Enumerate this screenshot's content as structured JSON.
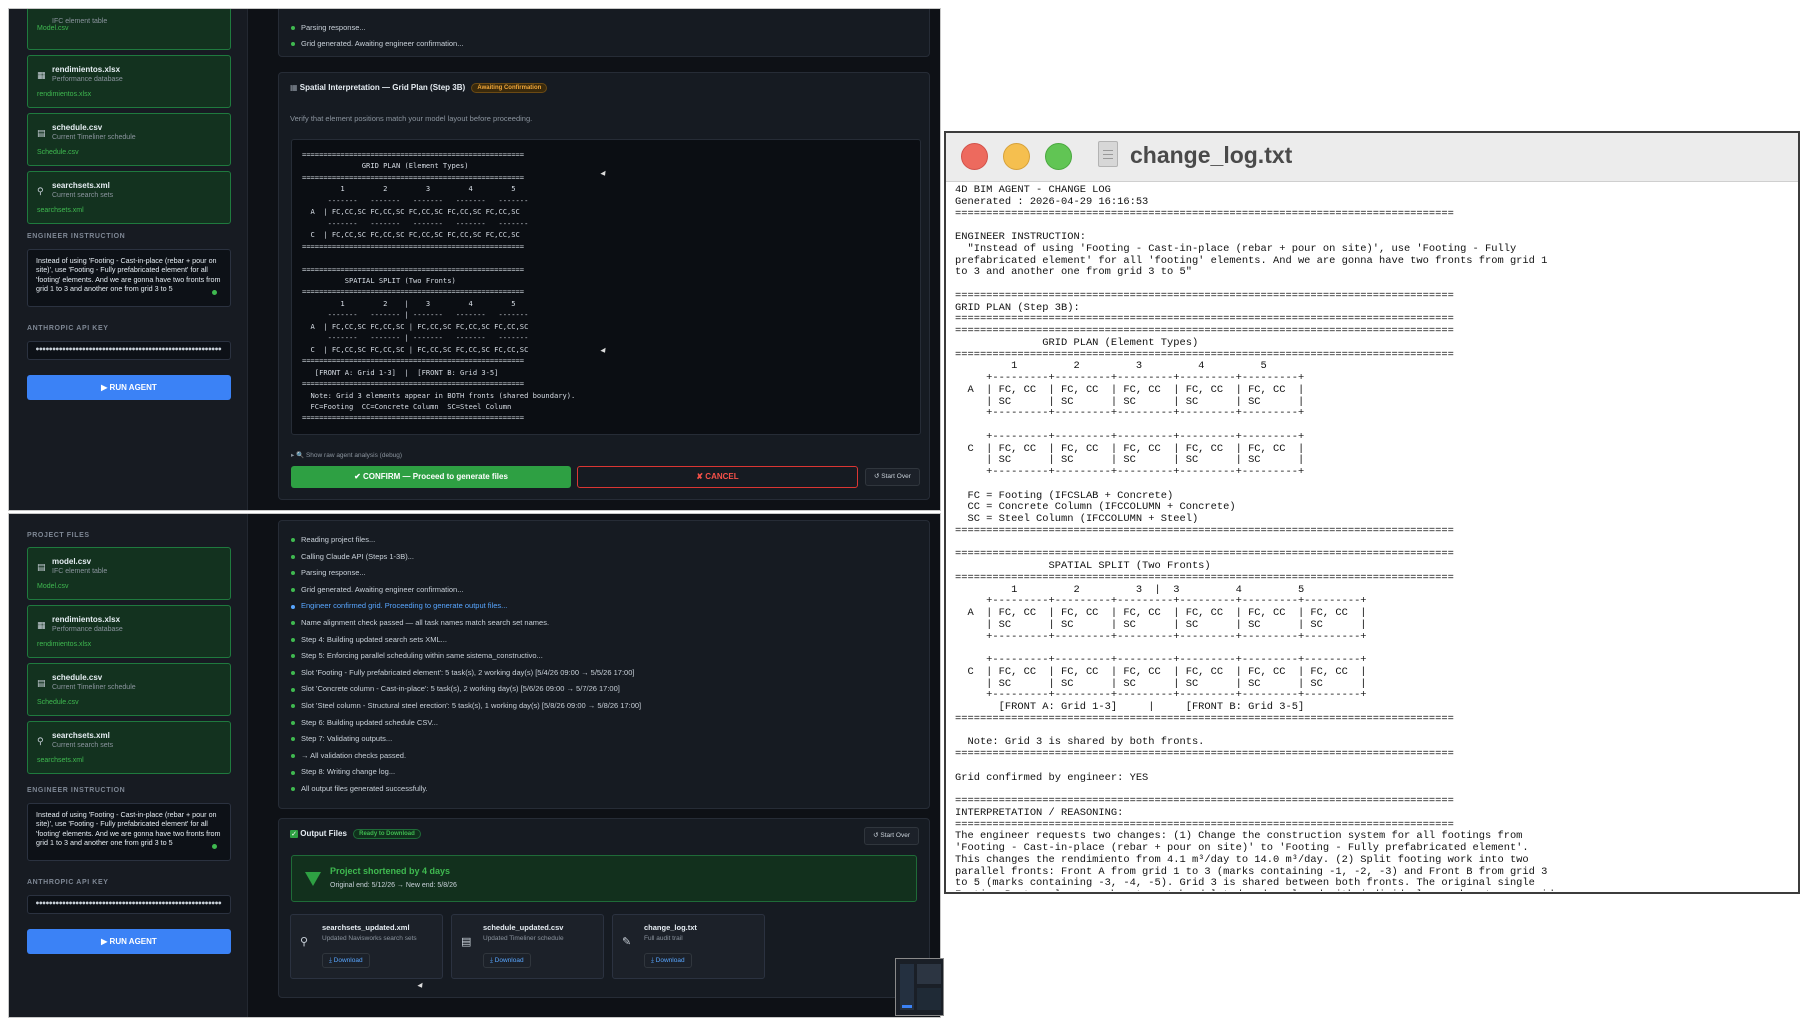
{
  "colors": {
    "app_bg": "#0e1116",
    "sidebar_bg": "#171b22",
    "card_bg": "#13321f",
    "card_border": "#1f7a3e",
    "accent_blue": "#3b82f6",
    "confirm_green": "#2ea043",
    "cancel_red": "#f85149",
    "badge_orange": "#f0a63a",
    "success_green": "#3fb950"
  },
  "top": {
    "sidebar": {
      "files": [
        {
          "desc": "IFC element table",
          "small": "Model.csv",
          "icon": "table-icon"
        },
        {
          "name": "rendimientos.xlsx",
          "desc": "Performance database",
          "small": "rendimientos.xlsx",
          "icon": "spreadsheet-icon"
        },
        {
          "name": "schedule.csv",
          "desc": "Current Timeliner schedule",
          "small": "Schedule.csv",
          "icon": "calendar-icon"
        },
        {
          "name": "searchsets.xml",
          "desc": "Current search sets",
          "small": "searchsets.xml",
          "icon": "search-icon"
        }
      ],
      "instruction_label": "ENGINEER INSTRUCTION",
      "instruction": "Instead of using 'Footing - Cast-in-place (rebar + pour on site)', use 'Footing - Fully prefabricated element' for all 'footing' elements. And we are gonna have two fronts from grid 1 to 3 and another one from grid 3 to 5",
      "api_label": "ANTHROPIC API KEY",
      "api_value": "••••••••••••••••••••••••••••••••••••••••••••••••••••••••",
      "run": "▶ RUN AGENT"
    },
    "log": [
      "Parsing response...",
      "Grid generated. Awaiting engineer confirmation..."
    ],
    "spatial": {
      "title": "Spatial Interpretation — Grid Plan (Step 3B)",
      "badge": "Awaiting Confirmation",
      "subtitle": "Verify that element positions match your model layout before proceeding.",
      "grid_text": "====================================================\n              GRID PLAN (Element Types)\n====================================================\n         1         2         3         4         5\n      -------   -------   -------   -------   -------\n  A  | FC,CC,SC FC,CC,SC FC,CC,SC FC,CC,SC FC,CC,SC\n      -------   -------   -------   -------   -------\n  C  | FC,CC,SC FC,CC,SC FC,CC,SC FC,CC,SC FC,CC,SC\n====================================================\n\n====================================================\n          SPATIAL SPLIT (Two Fronts)\n====================================================\n         1         2    |    3         4         5\n      -------   ------- | -------   -------   -------\n  A  | FC,CC,SC FC,CC,SC | FC,CC,SC FC,CC,SC FC,CC,SC\n      -------   ------- | -------   -------   -------\n  C  | FC,CC,SC FC,CC,SC | FC,CC,SC FC,CC,SC FC,CC,SC\n====================================================\n   [FRONT A: Grid 1-3]  |  [FRONT B: Grid 3-5]\n====================================================\n  Note: Grid 3 elements appear in BOTH fronts (shared boundary).\n  FC=Footing  CC=Concrete Column  SC=Steel Column\n====================================================",
      "debug": "▸ 🔍 Show raw agent analysis (debug)",
      "confirm": "✔ CONFIRM — Proceed to generate files",
      "cancel": "✘ CANCEL",
      "start_over": "↺ Start Over"
    }
  },
  "bottom": {
    "sidebar": {
      "project_files_label": "PROJECT FILES",
      "files": [
        {
          "name": "model.csv",
          "desc": "IFC element table",
          "small": "Model.csv",
          "icon": "table-icon"
        },
        {
          "name": "rendimientos.xlsx",
          "desc": "Performance database",
          "small": "rendimientos.xlsx",
          "icon": "spreadsheet-icon"
        },
        {
          "name": "schedule.csv",
          "desc": "Current Timeliner schedule",
          "small": "Schedule.csv",
          "icon": "calendar-icon"
        },
        {
          "name": "searchsets.xml",
          "desc": "Current search sets",
          "small": "searchsets.xml",
          "icon": "search-icon"
        }
      ],
      "instruction_label": "ENGINEER INSTRUCTION",
      "instruction": "Instead of using 'Footing - Cast-in-place (rebar + pour on site)', use 'Footing - Fully prefabricated element' for all 'footing' elements. And we are gonna have two fronts from grid 1 to 3 and another one from grid 3 to 5",
      "api_label": "ANTHROPIC API KEY",
      "api_value": "••••••••••••••••••••••••••••••••••••••••••••••••••••••••",
      "run": "▶ RUN AGENT"
    },
    "log": [
      "Reading project files...",
      "Calling Claude API (Steps 1-3B)...",
      "Parsing response...",
      "Grid generated. Awaiting engineer confirmation...",
      "Engineer confirmed grid. Proceeding to generate output files...",
      "Name alignment check passed — all task names match search set names.",
      "Step 4: Building updated search sets XML...",
      "Step 5: Enforcing parallel scheduling within same sistema_constructivo...",
      "Slot 'Footing - Fully prefabricated element': 5 task(s), 2 working day(s) [5/4/26 09:00 → 5/5/26 17:00]",
      "Slot 'Concrete column - Cast-in-place': 5 task(s), 2 working day(s) [5/6/26 09:00 → 5/7/26 17:00]",
      "Slot 'Steel column - Structural steel erection': 5 task(s), 1 working day(s) [5/8/26 09:00 → 5/8/26 17:00]",
      "Step 6: Building updated schedule CSV...",
      "Step 7: Validating outputs...",
      "→ All validation checks passed.",
      "Step 8: Writing change log...",
      "All output files generated successfully."
    ],
    "output": {
      "title": "Output Files",
      "badge": "Ready to Download",
      "start_over": "↺ Start Over",
      "banner_title": "Project shortened by 4 days",
      "banner_sub": "Original end: 5/12/26 → New end: 5/8/26",
      "files": [
        {
          "name": "searchsets_updated.xml",
          "desc": "Updated Navisworks search sets",
          "dl": "⤓ Download",
          "icon": "search-icon"
        },
        {
          "name": "schedule_updated.csv",
          "desc": "Updated Timeliner schedule",
          "dl": "⤓ Download",
          "icon": "calendar-icon"
        },
        {
          "name": "change_log.txt",
          "desc": "Full audit trail",
          "dl": "⤓ Download",
          "icon": "notepad-icon"
        }
      ]
    }
  },
  "textedit": {
    "title": "change_log.txt",
    "content": "4D BIM AGENT - CHANGE LOG\nGenerated : 2026-04-29 16:16:53\n================================================================================\n\nENGINEER INSTRUCTION:\n  \"Instead of using 'Footing - Cast-in-place (rebar + pour on site)', use 'Footing - Fully\nprefabricated element' for all 'footing' elements. And we are gonna have two fronts from grid 1\nto 3 and another one from grid 3 to 5\"\n\n================================================================================\nGRID PLAN (Step 3B):\n================================================================================\n================================================================================\n              GRID PLAN (Element Types)\n================================================================================\n         1         2         3         4         5\n     +---------+---------+---------+---------+---------+\n  A  | FC, CC  | FC, CC  | FC, CC  | FC, CC  | FC, CC  |\n     | SC      | SC      | SC      | SC      | SC      |\n     +---------+---------+---------+---------+---------+\n\n     +---------+---------+---------+---------+---------+\n  C  | FC, CC  | FC, CC  | FC, CC  | FC, CC  | FC, CC  |\n     | SC      | SC      | SC      | SC      | SC      |\n     +---------+---------+---------+---------+---------+\n\n  FC = Footing (IFCSLAB + Concrete)\n  CC = Concrete Column (IFCCOLUMN + Concrete)\n  SC = Steel Column (IFCCOLUMN + Steel)\n================================================================================\n\n================================================================================\n               SPATIAL SPLIT (Two Fronts)\n================================================================================\n         1         2         3  |  3         4         5\n     +---------+---------+---------+---------+---------+---------+\n  A  | FC, CC  | FC, CC  | FC, CC  | FC, CC  | FC, CC  | FC, CC  |\n     | SC      | SC      | SC      | SC      | SC      | SC      |\n     +---------+---------+---------+---------+---------+---------+\n\n     +---------+---------+---------+---------+---------+---------+\n  C  | FC, CC  | FC, CC  | FC, CC  | FC, CC  | FC, CC  | FC, CC  |\n     | SC      | SC      | SC      | SC      | SC      | SC      |\n     +---------+---------+---------+---------+---------+---------+\n       [FRONT A: Grid 1-3]     |     [FRONT B: Grid 3-5]\n================================================================================\n\n  Note: Grid 3 is shared by both fronts.\n================================================================================\n\nGrid confirmed by engineer: YES\n\n================================================================================\nINTERPRETATION / REASONING:\n================================================================================\nThe engineer requests two changes: (1) Change the construction system for all footings from\n'Footing - Cast-in-place (rebar + pour on site)' to 'Footing - Fully prefabricated element'.\nThis changes the rendimiento from 4.1 m³/day to 14.0 m³/day. (2) Split footing work into two\nparallel fronts: Front A from grid 1 to 3 (marks containing -1, -2, -3) and Front B from grid 3\nto 5 (marks containing -3, -4, -5). Grid 3 is shared between both fronts. The original single\nFooting-Rectangular search set must be deleted and replaced with individual search sets per grid\naxis for each front. Front A needs sets for -1, -2, -3. Front B needs sets for -3, -4, -5. Since\ngrid 3 appears in both fronts, we need separate search sets: Front A has marks -1, -2 -3 and\nFront B has marks -3, -4, -5. However, per the rule of ONE mark condition per search set, we"
  }
}
